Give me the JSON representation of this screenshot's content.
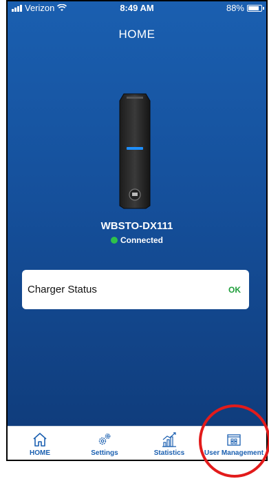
{
  "status_bar": {
    "carrier": "Verizon",
    "time": "8:49 AM",
    "battery": "88%",
    "battery_level": 0.88
  },
  "header": {
    "title": "HOME"
  },
  "device": {
    "name": "WBSTO-DX111",
    "connection_status": "Connected",
    "connection_color": "#2ec24a"
  },
  "charger_status": {
    "label": "Charger Status",
    "value": "OK",
    "value_color": "#1e9e3a"
  },
  "tabbar": {
    "tabs": [
      {
        "label": "HOME",
        "icon": "home-icon"
      },
      {
        "label": "Settings",
        "icon": "gears-icon"
      },
      {
        "label": "Statistics",
        "icon": "bar-chart-icon"
      },
      {
        "label": "User Management",
        "icon": "user-cards-icon"
      }
    ]
  },
  "colors": {
    "background_top": "#1a5fb0",
    "background_bottom": "#0f3a78",
    "accent": "#1a5fb0",
    "annotation": "#e21b1b"
  }
}
